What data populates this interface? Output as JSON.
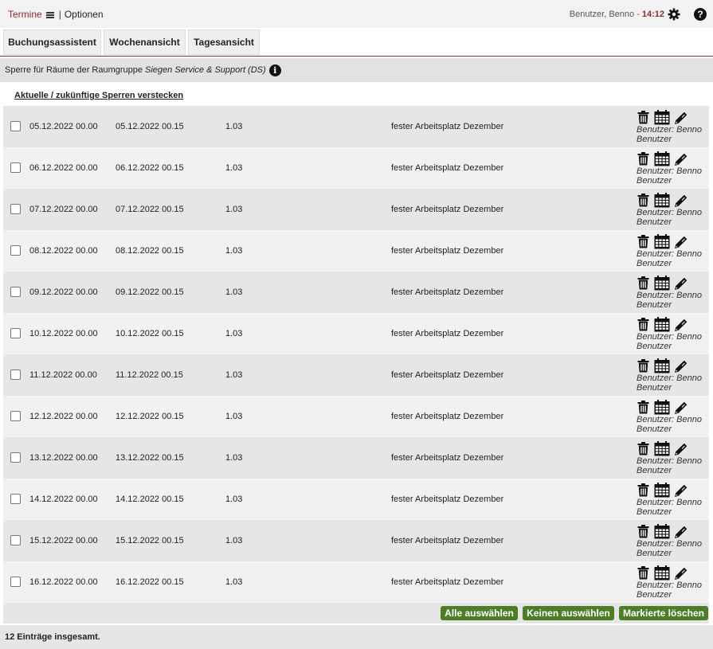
{
  "header": {
    "app_label": "Termine",
    "separator": "|",
    "options_label": "Optionen",
    "user_label": "Benutzer, Benno -",
    "time": "14:12"
  },
  "tabs": [
    {
      "label": "Buchungsassistent"
    },
    {
      "label": "Wochenansicht"
    },
    {
      "label": "Tagesansicht"
    }
  ],
  "section": {
    "title_prefix": "Sperre für Räume der Raumgruppe",
    "group_name": "Siegen Service & Support (DS)"
  },
  "toggle_link": "Aktuelle / zukünftige Sperren verstecken",
  "rows": [
    {
      "start": "05.12.2022 00.00",
      "end": "05.12.2022 00.15",
      "room": "1.03",
      "reason": "fester Arbeitsplatz Dezember",
      "user": "Benutzer: Benno Benutzer"
    },
    {
      "start": "06.12.2022 00.00",
      "end": "06.12.2022 00.15",
      "room": "1.03",
      "reason": "fester Arbeitsplatz Dezember",
      "user": "Benutzer: Benno Benutzer"
    },
    {
      "start": "07.12.2022 00.00",
      "end": "07.12.2022 00.15",
      "room": "1.03",
      "reason": "fester Arbeitsplatz Dezember",
      "user": "Benutzer: Benno Benutzer"
    },
    {
      "start": "08.12.2022 00.00",
      "end": "08.12.2022 00.15",
      "room": "1.03",
      "reason": "fester Arbeitsplatz Dezember",
      "user": "Benutzer: Benno Benutzer"
    },
    {
      "start": "09.12.2022 00.00",
      "end": "09.12.2022 00.15",
      "room": "1.03",
      "reason": "fester Arbeitsplatz Dezember",
      "user": "Benutzer: Benno Benutzer"
    },
    {
      "start": "10.12.2022 00.00",
      "end": "10.12.2022 00.15",
      "room": "1.03",
      "reason": "fester Arbeitsplatz Dezember",
      "user": "Benutzer: Benno Benutzer"
    },
    {
      "start": "11.12.2022 00.00",
      "end": "11.12.2022 00.15",
      "room": "1.03",
      "reason": "fester Arbeitsplatz Dezember",
      "user": "Benutzer: Benno Benutzer"
    },
    {
      "start": "12.12.2022 00.00",
      "end": "12.12.2022 00.15",
      "room": "1.03",
      "reason": "fester Arbeitsplatz Dezember",
      "user": "Benutzer: Benno Benutzer"
    },
    {
      "start": "13.12.2022 00.00",
      "end": "13.12.2022 00.15",
      "room": "1.03",
      "reason": "fester Arbeitsplatz Dezember",
      "user": "Benutzer: Benno Benutzer"
    },
    {
      "start": "14.12.2022 00.00",
      "end": "14.12.2022 00.15",
      "room": "1.03",
      "reason": "fester Arbeitsplatz Dezember",
      "user": "Benutzer: Benno Benutzer"
    },
    {
      "start": "15.12.2022 00.00",
      "end": "15.12.2022 00.15",
      "room": "1.03",
      "reason": "fester Arbeitsplatz Dezember",
      "user": "Benutzer: Benno Benutzer"
    },
    {
      "start": "16.12.2022 00.00",
      "end": "16.12.2022 00.15",
      "room": "1.03",
      "reason": "fester Arbeitsplatz Dezember",
      "user": "Benutzer: Benno Benutzer"
    }
  ],
  "row_icons": [
    "trash-icon",
    "calendar-icon",
    "pencil-icon"
  ],
  "actions": {
    "select_all": "Alle auswählen",
    "select_none": "Keinen auswählen",
    "delete_marked": "Markierte löschen"
  },
  "footer": {
    "count_text": "12 Einträge insgesamt."
  },
  "colors": {
    "brand": "#8b2b2b",
    "button_green": "#4d7d27"
  }
}
